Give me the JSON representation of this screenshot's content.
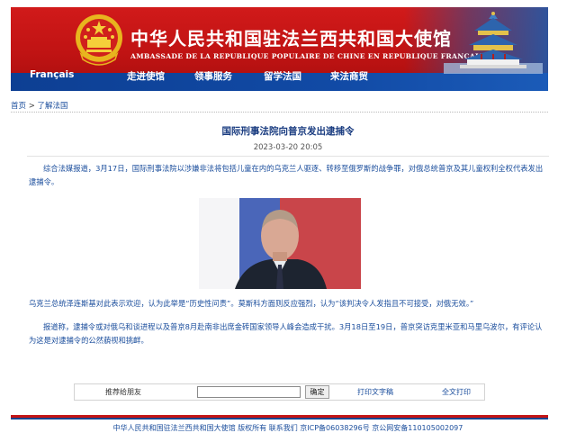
{
  "header": {
    "title_zh": "中华人民共和国驻法兰西共和国大使馆",
    "title_fr": "AMBASSADE DE LA REPUBLIQUE POPULAIRE DE CHINE EN REPUBLIQUE FRANCAISE",
    "emblem_icon": "national-emblem-icon",
    "temple_icon": "temple-of-heaven-icon"
  },
  "nav": {
    "items": [
      "Français",
      "走进使馆",
      "领事服务",
      "留学法国",
      "来法商贸"
    ]
  },
  "breadcrumb": {
    "home": "首页",
    "separator": ">",
    "current": "了解法国"
  },
  "article": {
    "title": "国际刑事法院向普京发出逮捕令",
    "date": "2023-03-20 20:05",
    "paragraphs": [
      "综合法媒报道，3月17日，国际刑事法院以涉嫌非法将包括儿童在内的乌克兰人驱逐、转移至俄罗斯的战争罪，对俄总统普京及其儿童权利全权代表发出逮捕令。",
      "乌克兰总统泽连斯基对此表示欢迎，认为此举是“历史性问责”。莫斯科方面则反应强烈，认为“该判决令人发指且不可接受，对俄无效。”",
      "报道称，逮捕令或对俄乌和谈进程以及普京8月赴南非出席金砖国家领导人峰会造成干扰。3月18日至19日，普京突访克里米亚和马里乌波尔，有评论认为这是对逮捕令的公然藐视和挑衅。"
    ]
  },
  "toolbar": {
    "share_label": "推荐给朋友",
    "share_value": "",
    "ok_label": "确定",
    "print_label": "打印文字稿",
    "fullprint_label": "全文打印"
  },
  "footer": {
    "text": "中华人民共和国驻法兰西共和国大使馆 版权所有 联系我们 京ICP备06038296号 京公网安备11010500209​7"
  },
  "colors": {
    "banner_red": "#c01313",
    "banner_blue": "#114aa5",
    "link_blue": "#1a4d9c",
    "title_blue": "#1a3c80"
  }
}
